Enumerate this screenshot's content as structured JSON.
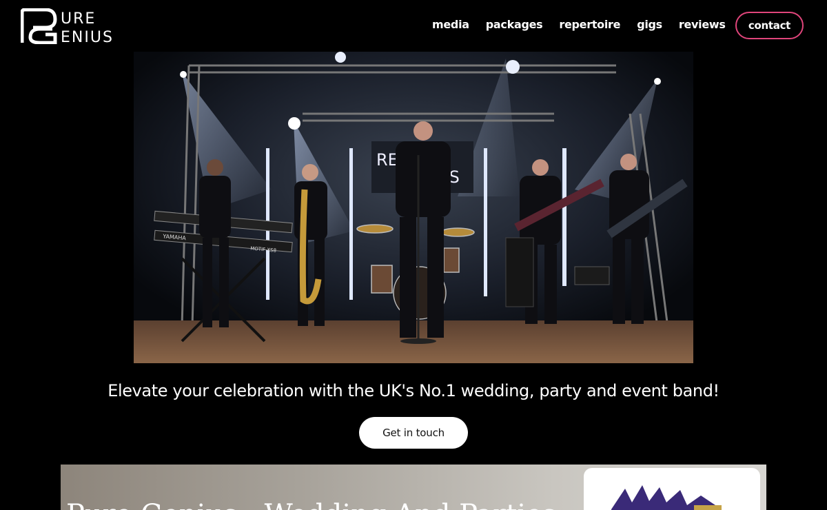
{
  "brand": {
    "name": "Pure Genius",
    "logo_text_top": "URE",
    "logo_text_bottom": "ENIUS"
  },
  "nav": {
    "items": [
      {
        "label": "media"
      },
      {
        "label": "packages"
      },
      {
        "label": "repertoire"
      },
      {
        "label": "gigs"
      },
      {
        "label": "reviews"
      }
    ],
    "contact_label": "contact"
  },
  "hero": {
    "backdrop_logo_top": "RE",
    "backdrop_logo_bottom": "US",
    "keyboard_brand": "YAMAHA",
    "keyboard_model": "MOTIF XS8"
  },
  "tagline": "Elevate your celebration with the UK's No.1 wedding, party and event band!",
  "cta_label": "Get in touch",
  "lower": {
    "title": "Pure Genius - Wedding And Parties"
  },
  "colors": {
    "accent": "#e0457b",
    "background": "#000000",
    "cta_bg": "#ffffff"
  }
}
